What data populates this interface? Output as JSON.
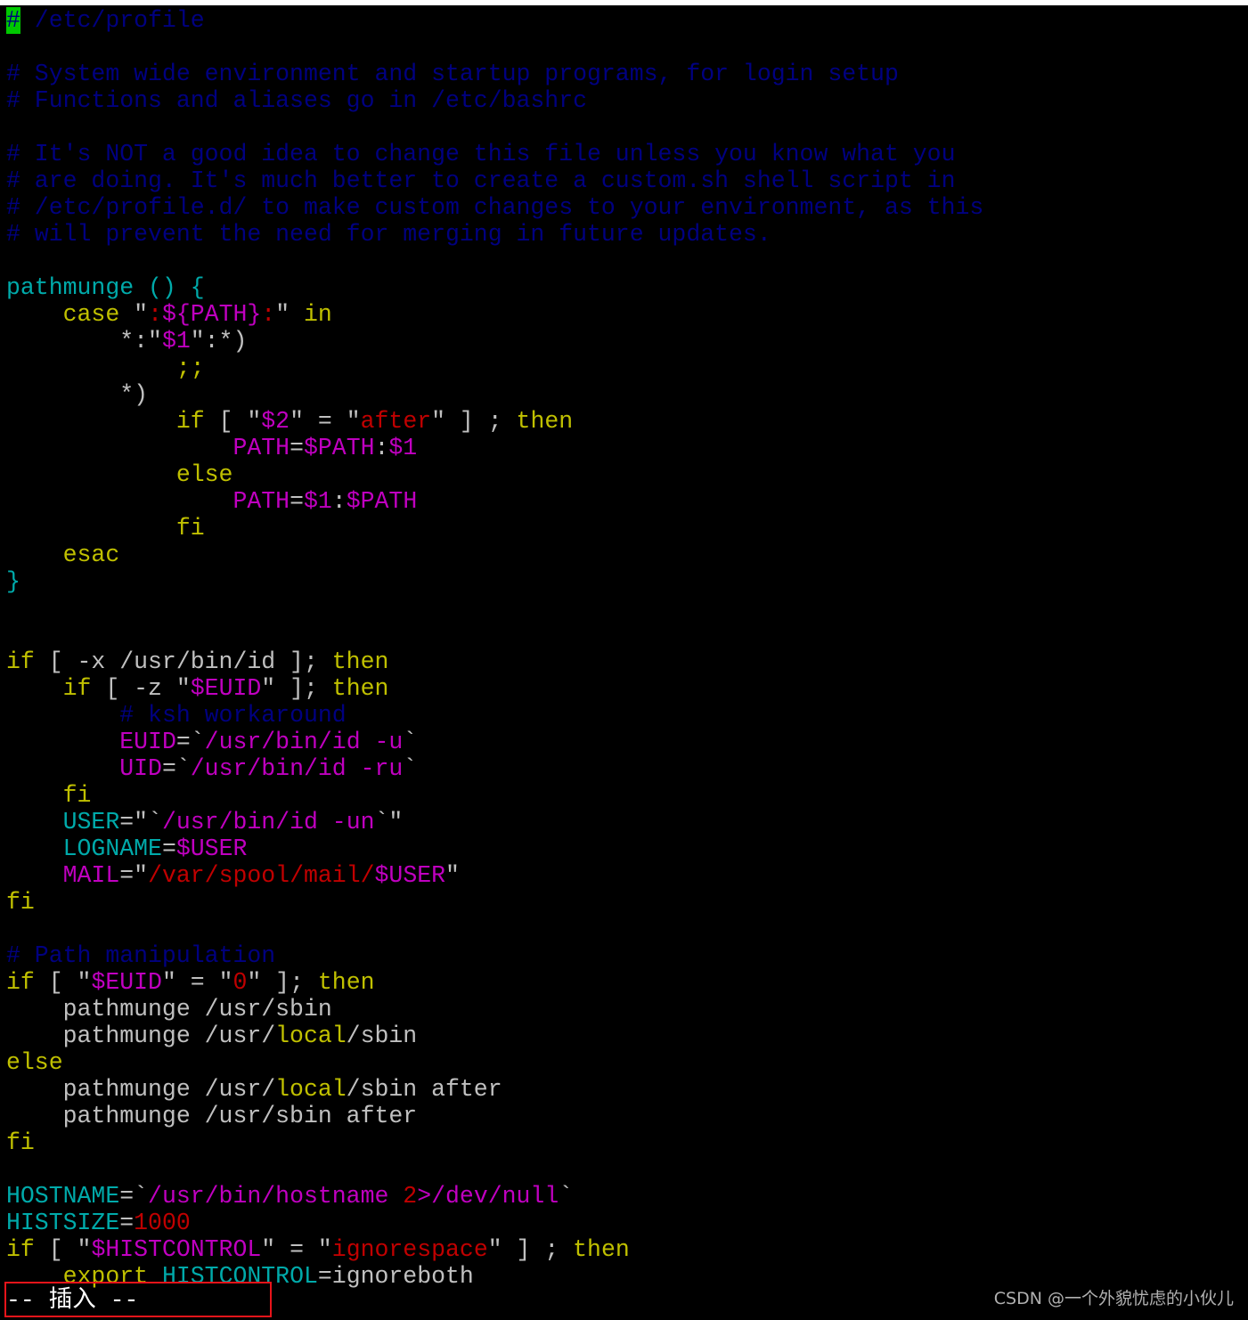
{
  "colors": {
    "background": "#000000",
    "default_text": "#c0c0c0",
    "comment": "#000080",
    "keyword": "#c0c000",
    "identifier": "#00aaaa",
    "string": "#c00000",
    "variable": "#c000c0",
    "cursor": "#00c800",
    "highlight_box": "#e8141a"
  },
  "editor": {
    "lines": [
      [
        {
          "t": "#",
          "c": "cursor"
        },
        {
          "t": " /etc/profile",
          "c": "comment"
        }
      ],
      [],
      [
        {
          "t": "# System wide environment and startup programs, for login setup",
          "c": "comment"
        }
      ],
      [
        {
          "t": "# Functions and aliases go in /etc/bashrc",
          "c": "comment"
        }
      ],
      [],
      [
        {
          "t": "# It's NOT a good idea to change this file unless you know what you",
          "c": "comment"
        }
      ],
      [
        {
          "t": "# are doing. It's much better to create a custom.sh shell script in",
          "c": "comment"
        }
      ],
      [
        {
          "t": "# /etc/profile.d/ to make custom changes to your environment, as this",
          "c": "comment"
        }
      ],
      [
        {
          "t": "# will prevent the need for merging in future updates.",
          "c": "comment"
        }
      ],
      [],
      [
        {
          "t": "pathmunge () {",
          "c": "identifier"
        }
      ],
      [
        {
          "t": "    "
        },
        {
          "t": "case",
          "c": "keyword"
        },
        {
          "t": " \""
        },
        {
          "t": ":",
          "c": "string"
        },
        {
          "t": "${PATH}",
          "c": "variable"
        },
        {
          "t": ":",
          "c": "string"
        },
        {
          "t": "\" "
        },
        {
          "t": "in",
          "c": "keyword"
        }
      ],
      [
        {
          "t": "        *:\""
        },
        {
          "t": "$1",
          "c": "variable"
        },
        {
          "t": "\":*)",
          "c": "default"
        }
      ],
      [
        {
          "t": "            "
        },
        {
          "t": ";;",
          "c": "keyword"
        }
      ],
      [
        {
          "t": "        *)"
        }
      ],
      [
        {
          "t": "            "
        },
        {
          "t": "if",
          "c": "keyword"
        },
        {
          "t": " [ \""
        },
        {
          "t": "$2",
          "c": "variable"
        },
        {
          "t": "\" = \""
        },
        {
          "t": "after",
          "c": "string"
        },
        {
          "t": "\" ] ; "
        },
        {
          "t": "then",
          "c": "keyword"
        }
      ],
      [
        {
          "t": "                "
        },
        {
          "t": "PATH",
          "c": "variable"
        },
        {
          "t": "="
        },
        {
          "t": "$PATH",
          "c": "variable"
        },
        {
          "t": ":"
        },
        {
          "t": "$1",
          "c": "variable"
        }
      ],
      [
        {
          "t": "            "
        },
        {
          "t": "else",
          "c": "keyword"
        }
      ],
      [
        {
          "t": "                "
        },
        {
          "t": "PATH",
          "c": "variable"
        },
        {
          "t": "="
        },
        {
          "t": "$1",
          "c": "variable"
        },
        {
          "t": ":"
        },
        {
          "t": "$PATH",
          "c": "variable"
        }
      ],
      [
        {
          "t": "            "
        },
        {
          "t": "fi",
          "c": "keyword"
        }
      ],
      [
        {
          "t": "    "
        },
        {
          "t": "esac",
          "c": "keyword"
        }
      ],
      [
        {
          "t": "}",
          "c": "identifier"
        }
      ],
      [],
      [],
      [
        {
          "t": "if",
          "c": "keyword"
        },
        {
          "t": " [ -x /usr/bin/id ]; "
        },
        {
          "t": "then",
          "c": "keyword"
        }
      ],
      [
        {
          "t": "    "
        },
        {
          "t": "if",
          "c": "keyword"
        },
        {
          "t": " [ -z \""
        },
        {
          "t": "$EUID",
          "c": "variable"
        },
        {
          "t": "\" ]; "
        },
        {
          "t": "then",
          "c": "keyword"
        }
      ],
      [
        {
          "t": "        "
        },
        {
          "t": "# ksh workaround",
          "c": "comment"
        }
      ],
      [
        {
          "t": "        "
        },
        {
          "t": "EUID",
          "c": "variable"
        },
        {
          "t": "=`"
        },
        {
          "t": "/usr/bin/id -u",
          "c": "variable"
        },
        {
          "t": "`"
        }
      ],
      [
        {
          "t": "        "
        },
        {
          "t": "UID",
          "c": "variable"
        },
        {
          "t": "=`"
        },
        {
          "t": "/usr/bin/id -ru",
          "c": "variable"
        },
        {
          "t": "`"
        }
      ],
      [
        {
          "t": "    "
        },
        {
          "t": "fi",
          "c": "keyword"
        }
      ],
      [
        {
          "t": "    "
        },
        {
          "t": "USER",
          "c": "identifier"
        },
        {
          "t": "=\"`"
        },
        {
          "t": "/usr/bin/id -un",
          "c": "variable"
        },
        {
          "t": "`\""
        }
      ],
      [
        {
          "t": "    "
        },
        {
          "t": "LOGNAME",
          "c": "identifier"
        },
        {
          "t": "="
        },
        {
          "t": "$USER",
          "c": "variable"
        }
      ],
      [
        {
          "t": "    "
        },
        {
          "t": "MAIL",
          "c": "variable"
        },
        {
          "t": "=\""
        },
        {
          "t": "/var/spool/mail/",
          "c": "string"
        },
        {
          "t": "$USER",
          "c": "variable"
        },
        {
          "t": "\""
        }
      ],
      [
        {
          "t": "fi",
          "c": "keyword"
        }
      ],
      [],
      [
        {
          "t": "# Path manipulation",
          "c": "comment"
        }
      ],
      [
        {
          "t": "if",
          "c": "keyword"
        },
        {
          "t": " [ \""
        },
        {
          "t": "$EUID",
          "c": "variable"
        },
        {
          "t": "\" = \""
        },
        {
          "t": "0",
          "c": "string"
        },
        {
          "t": "\" ]; "
        },
        {
          "t": "then",
          "c": "keyword"
        }
      ],
      [
        {
          "t": "    pathmunge /usr/sbin"
        }
      ],
      [
        {
          "t": "    pathmunge /usr/"
        },
        {
          "t": "local",
          "c": "keyword"
        },
        {
          "t": "/sbin"
        }
      ],
      [
        {
          "t": "else",
          "c": "keyword"
        }
      ],
      [
        {
          "t": "    pathmunge /usr/"
        },
        {
          "t": "local",
          "c": "keyword"
        },
        {
          "t": "/sbin after"
        }
      ],
      [
        {
          "t": "    pathmunge /usr/sbin after"
        }
      ],
      [
        {
          "t": "fi",
          "c": "keyword"
        }
      ],
      [],
      [
        {
          "t": "HOSTNAME",
          "c": "identifier"
        },
        {
          "t": "=`"
        },
        {
          "t": "/usr/bin/hostname ",
          "c": "variable"
        },
        {
          "t": "2",
          "c": "string"
        },
        {
          "t": ">",
          "c": "variable"
        },
        {
          "t": "/dev/null",
          "c": "variable"
        },
        {
          "t": "`"
        }
      ],
      [
        {
          "t": "HISTSIZE",
          "c": "identifier"
        },
        {
          "t": "="
        },
        {
          "t": "1000",
          "c": "string"
        }
      ],
      [
        {
          "t": "if",
          "c": "keyword"
        },
        {
          "t": " [ \""
        },
        {
          "t": "$HISTCONTROL",
          "c": "variable"
        },
        {
          "t": "\" = \""
        },
        {
          "t": "ignorespace",
          "c": "string"
        },
        {
          "t": "\" ] ; "
        },
        {
          "t": "then",
          "c": "keyword"
        }
      ],
      [
        {
          "t": "    "
        },
        {
          "t": "export",
          "c": "keyword"
        },
        {
          "t": " "
        },
        {
          "t": "HISTCONTROL",
          "c": "identifier"
        },
        {
          "t": "=ignoreboth"
        }
      ]
    ]
  },
  "status_bar": {
    "mode_text": "-- 插入 --"
  },
  "watermark": {
    "text": "CSDN @一个外貌忧虑的小伙儿"
  }
}
